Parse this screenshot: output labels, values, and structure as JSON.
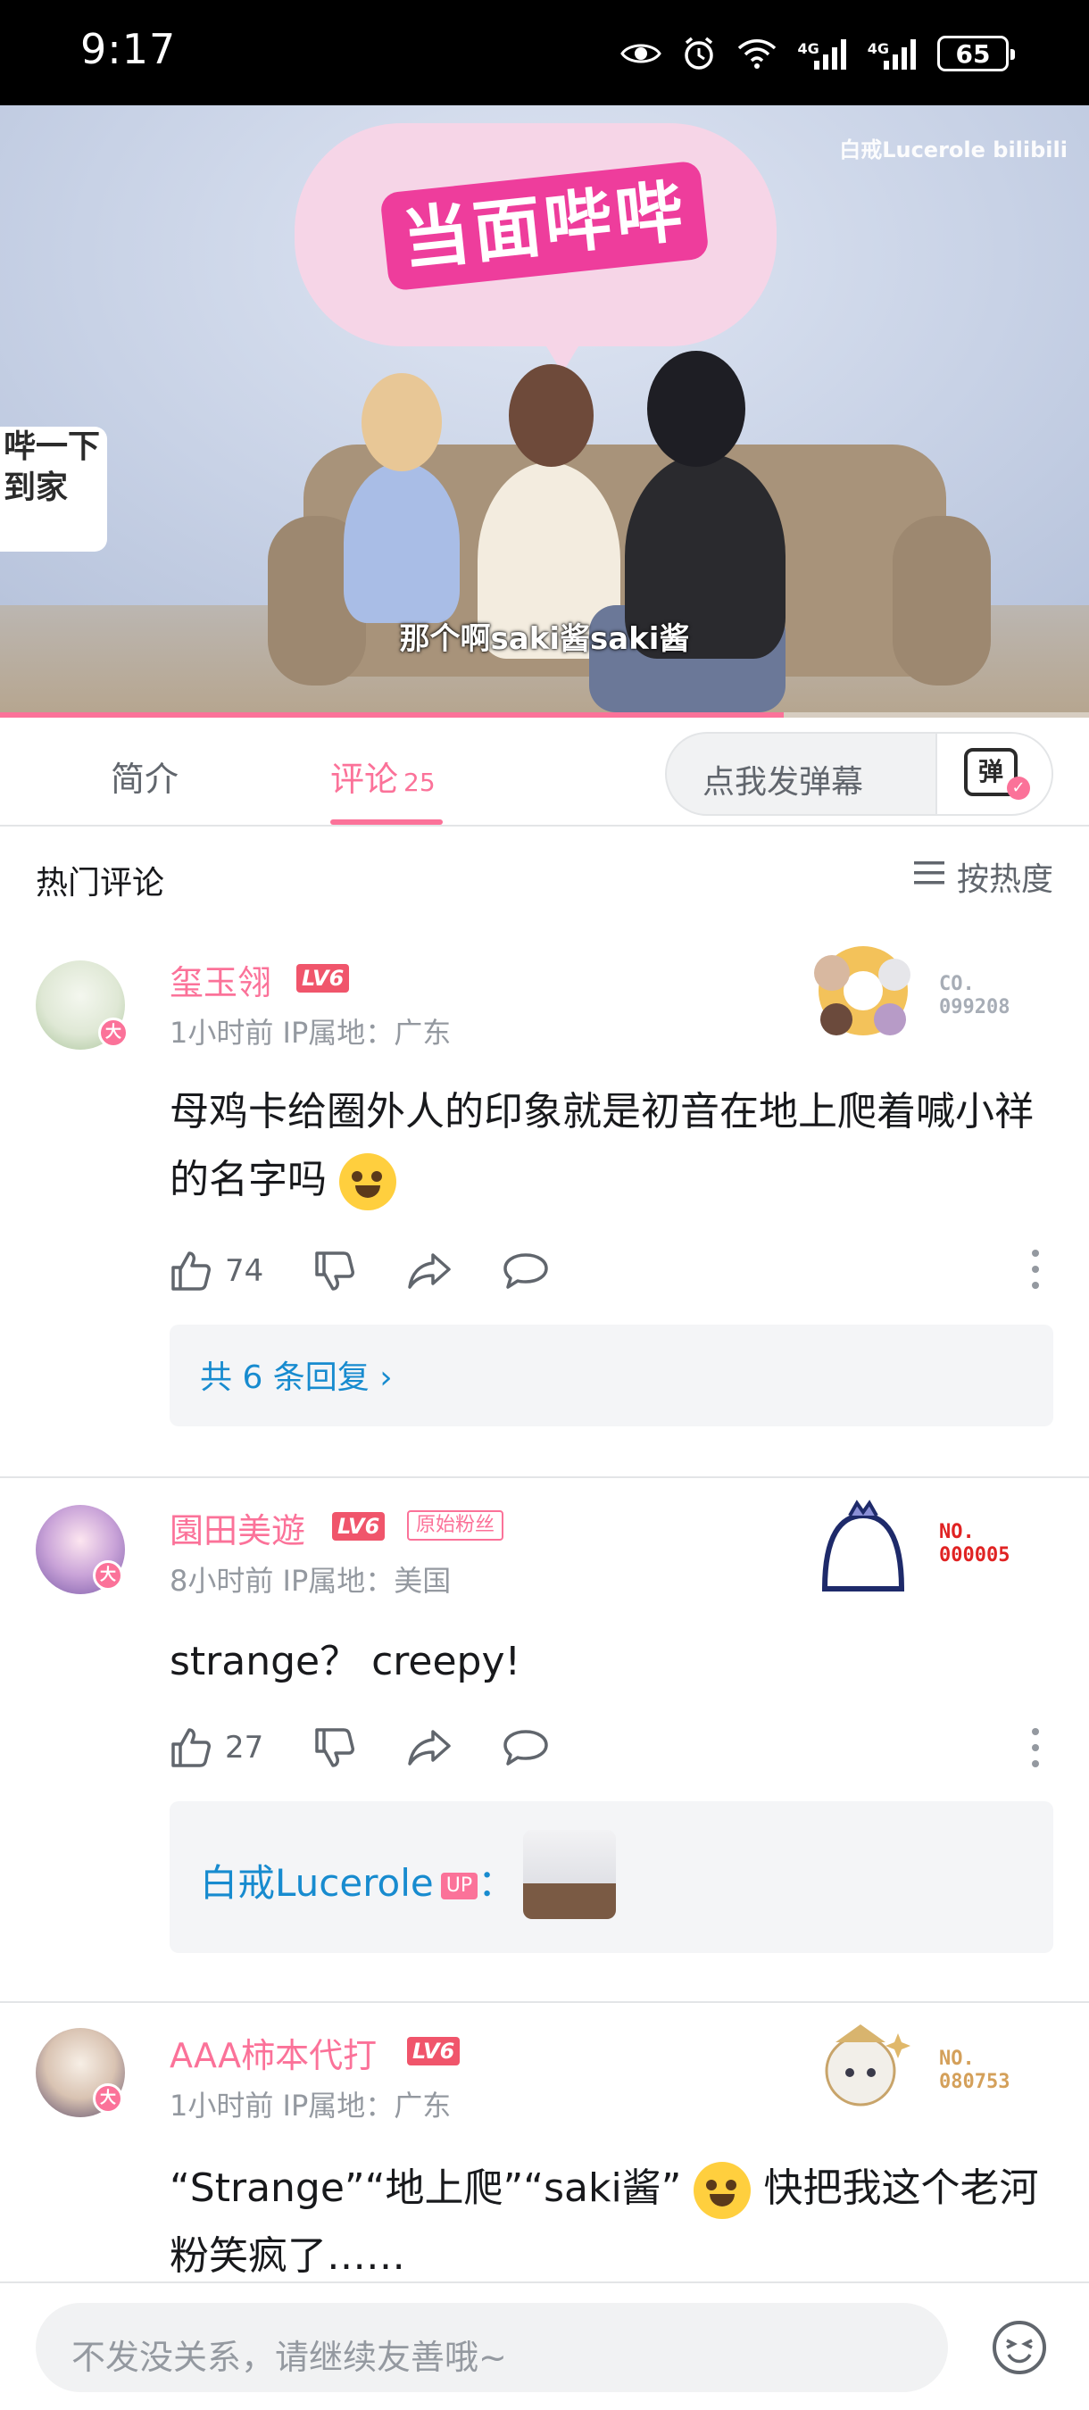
{
  "status_bar": {
    "time": "9:17",
    "network1": "4G",
    "network2": "4G",
    "battery": "65",
    "icons": [
      "eye-icon",
      "alarm-icon",
      "wifi-icon",
      "signal-icon",
      "signal-icon",
      "battery-icon"
    ]
  },
  "video": {
    "watermark": "白戒Lucerole bilibili",
    "logo_text": "当面哔哔",
    "side_sign": "哔一下 到家",
    "subtitle": "那个啊saki酱saki酱",
    "progress": 0.72
  },
  "tabs": {
    "intro_label": "简介",
    "comments_label": "评论",
    "comments_count": "25",
    "danmaku_placeholder": "点我发弹幕",
    "danmaku_button_glyph": "弹"
  },
  "section": {
    "title": "热门评论",
    "sort_label": "按热度"
  },
  "comments": [
    {
      "username": "玺玉翎",
      "level": "LV6",
      "avatar_badge": "大",
      "meta": "1小时前 IP属地：广东",
      "content": "母鸡卡给圈外人的印象就是初音在地上爬着喊小祥的名字吗",
      "likes": "74",
      "garb_no_label": "CO.",
      "garb_no_value": "099208",
      "garb_color": "#a7adb6",
      "replies_label": "共 6 条回复 ›"
    },
    {
      "username": "園田美遊",
      "level": "LV6",
      "fan_badge": "原始粉丝",
      "avatar_badge": "大",
      "meta": "8小时前 IP属地：美国",
      "content": "strange？ creepy!",
      "likes": "27",
      "garb_no_label": "NO.",
      "garb_no_value": "000005",
      "garb_color": "#e02323",
      "reply_author": "白戒Lucerole",
      "reply_up_tag": "UP",
      "reply_sep": "："
    },
    {
      "username": "AAA柿本代打",
      "level": "LV6",
      "avatar_badge": "大",
      "meta": "1小时前 IP属地：广东",
      "content": "“Strange”“地上爬”“saki酱”",
      "content_tail": "快把我这个老河粉笑疯了……",
      "garb_no_label": "NO.",
      "garb_no_value": "080753",
      "garb_color": "#d4a05a"
    }
  ],
  "bottom": {
    "placeholder": "不发没关系，请继续友善哦~"
  },
  "colors": {
    "accent": "#fb7299",
    "link": "#178bcf",
    "level": "#f0556b",
    "muted": "#9499a0"
  }
}
